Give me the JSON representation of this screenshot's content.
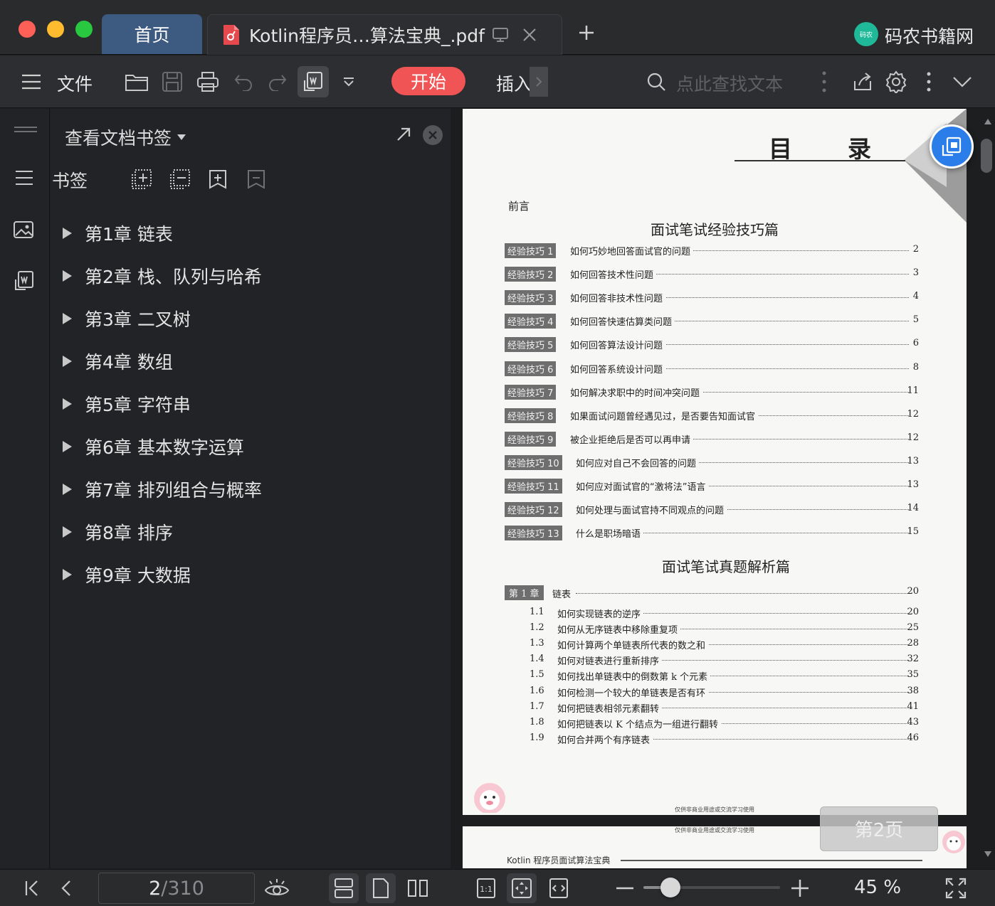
{
  "window": {
    "tabs": [
      {
        "label": "首页"
      },
      {
        "label": "Kotlin程序员…算法宝典_.pdf"
      }
    ],
    "brand": "码农书籍网",
    "brand_logo_text": "码农"
  },
  "toolbar": {
    "file_label": "文件",
    "start_label": "开始",
    "insert_label": "插入",
    "search_placeholder": "点此查找文本"
  },
  "sidebar": {
    "title": "查看文档书签",
    "section_label": "书签",
    "chapters": [
      {
        "label": "第1章 链表"
      },
      {
        "label": "第2章 栈、队列与哈希"
      },
      {
        "label": "第3章 二叉树"
      },
      {
        "label": "第4章 数组"
      },
      {
        "label": "第5章 字符串"
      },
      {
        "label": "第6章 基本数字运算"
      },
      {
        "label": "第7章 排列组合与概率"
      },
      {
        "label": "第8章 排序"
      },
      {
        "label": "第9章 大数据"
      }
    ]
  },
  "document": {
    "toc_title": "目　　录",
    "preface": "前言",
    "part1_title": "面试笔试经验技巧篇",
    "tips": [
      {
        "badge": "经验技巧 1",
        "text": "如何巧妙地回答面试官的问题",
        "page": "2"
      },
      {
        "badge": "经验技巧 2",
        "text": "如何回答技术性问题",
        "page": "3"
      },
      {
        "badge": "经验技巧 3",
        "text": "如何回答非技术性问题",
        "page": "4"
      },
      {
        "badge": "经验技巧 4",
        "text": "如何回答快速估算类问题",
        "page": "5"
      },
      {
        "badge": "经验技巧 5",
        "text": "如何回答算法设计问题",
        "page": "6"
      },
      {
        "badge": "经验技巧 6",
        "text": "如何回答系统设计问题",
        "page": "8"
      },
      {
        "badge": "经验技巧 7",
        "text": "如何解决求职中的时间冲突问题",
        "page": "11"
      },
      {
        "badge": "经验技巧 8",
        "text": "如果面试问题曾经遇见过，是否要告知面试官",
        "page": "12"
      },
      {
        "badge": "经验技巧 9",
        "text": "被企业拒绝后是否可以再申请",
        "page": "12"
      },
      {
        "badge": "经验技巧 10",
        "text": "如何应对自己不会回答的问题",
        "page": "13"
      },
      {
        "badge": "经验技巧 11",
        "text": "如何应对面试官的“激将法”语言",
        "page": "13"
      },
      {
        "badge": "经验技巧 12",
        "text": "如何处理与面试官持不同观点的问题",
        "page": "14"
      },
      {
        "badge": "经验技巧 13",
        "text": "什么是职场暗语",
        "page": "15"
      }
    ],
    "part2_title": "面试笔试真题解析篇",
    "chapter1": {
      "badge": "第 1 章",
      "text": "链表",
      "page": "20"
    },
    "sections": [
      {
        "num": "1.1",
        "text": "如何实现链表的逆序",
        "page": "20"
      },
      {
        "num": "1.2",
        "text": "如何从无序链表中移除重复项",
        "page": "25"
      },
      {
        "num": "1.3",
        "text": "如何计算两个单链表所代表的数之和",
        "page": "28"
      },
      {
        "num": "1.4",
        "text": "如何对链表进行重新排序",
        "page": "32"
      },
      {
        "num": "1.5",
        "text": "如何找出单链表中的倒数第 k 个元素",
        "page": "35"
      },
      {
        "num": "1.6",
        "text": "如何检测一个较大的单链表是否有环",
        "page": "38"
      },
      {
        "num": "1.7",
        "text": "如何把链表相邻元素翻转",
        "page": "41"
      },
      {
        "num": "1.8",
        "text": "如何把链表以 K 个结点为一组进行翻转",
        "page": "43"
      },
      {
        "num": "1.9",
        "text": "如何合并两个有序链表",
        "page": "46"
      }
    ],
    "footer_note": "仅供非商业用途或交流学习使用",
    "page2_note": "仅供非商业用途或交流学习使用",
    "page2_header": "Kotlin 程序员面试算法宝典",
    "page_badge": "第2页"
  },
  "statusbar": {
    "current_page": "2",
    "total_pages": "/310",
    "zoom": "45 %",
    "zoom_level": 0.2
  },
  "colors": {
    "accent_red": "#f05454",
    "tab_blue": "#3d5a80",
    "float_button": "#2b7de9"
  }
}
